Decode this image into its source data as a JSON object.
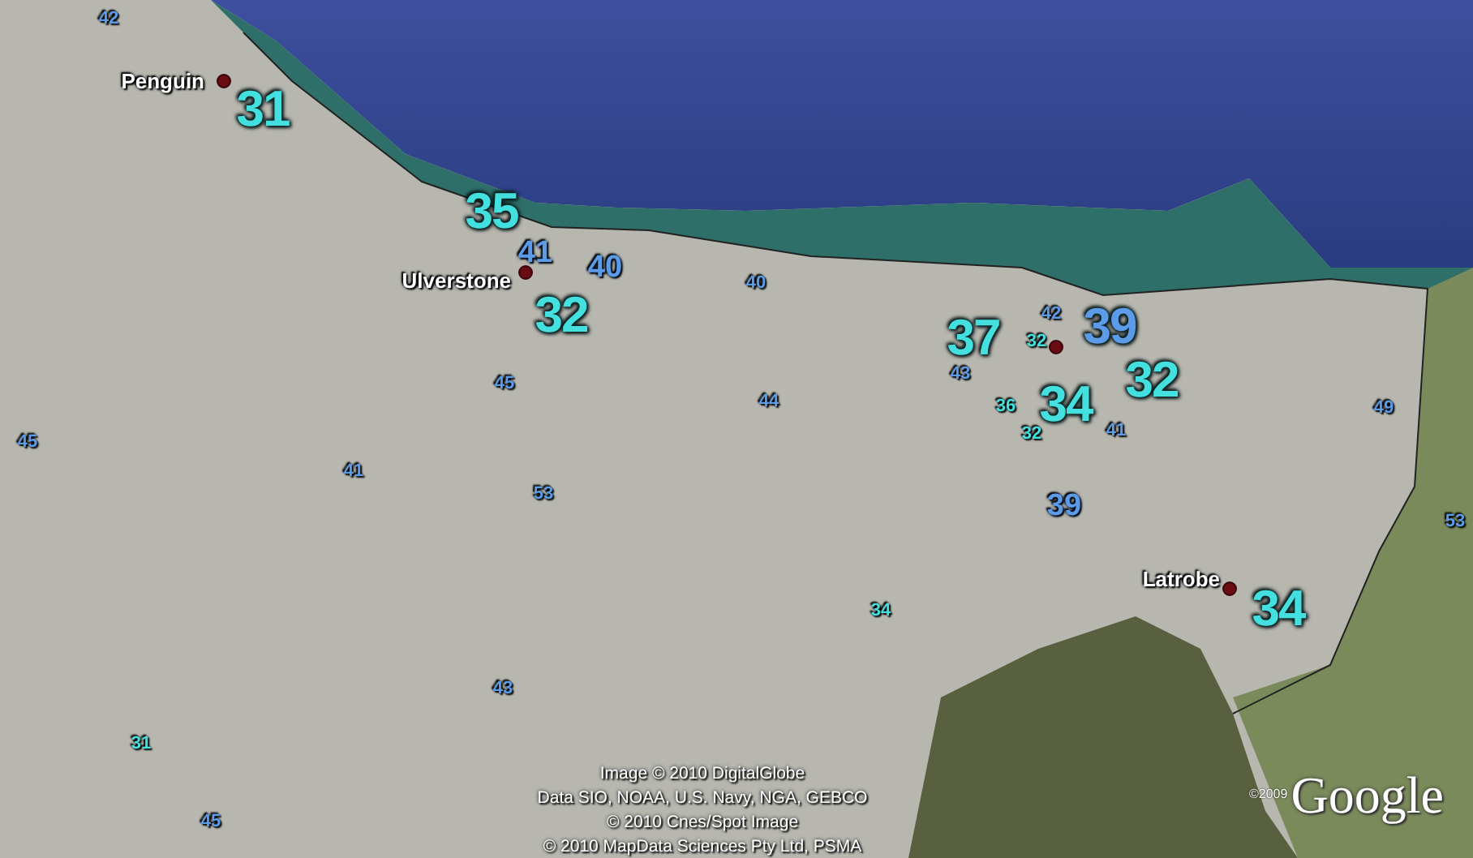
{
  "places": [
    {
      "name": "Penguin"
    },
    {
      "name": "Ulverstone"
    },
    {
      "name": "Latrobe"
    }
  ],
  "results": [
    {
      "value": "42",
      "color": "#5b9be8",
      "kind": "small"
    },
    {
      "value": "31",
      "color": "#44e0e0",
      "kind": "large"
    },
    {
      "value": "35",
      "color": "#44e0e0",
      "kind": "large"
    },
    {
      "value": "41",
      "color": "#5b9be8",
      "kind": "medium"
    },
    {
      "value": "40",
      "color": "#5b9be8",
      "kind": "medium"
    },
    {
      "value": "32",
      "color": "#44e0e0",
      "kind": "large"
    },
    {
      "value": "40",
      "color": "#5b9be8",
      "kind": "small"
    },
    {
      "value": "37",
      "color": "#44e0e0",
      "kind": "large"
    },
    {
      "value": "42",
      "color": "#5b9be8",
      "kind": "small"
    },
    {
      "value": "32",
      "color": "#44e0e0",
      "kind": "small"
    },
    {
      "value": "39",
      "color": "#5b9be8",
      "kind": "large"
    },
    {
      "value": "43",
      "color": "#5b9be8",
      "kind": "small"
    },
    {
      "value": "32",
      "color": "#44e0e0",
      "kind": "large"
    },
    {
      "value": "44",
      "color": "#5b9be8",
      "kind": "small"
    },
    {
      "value": "36",
      "color": "#44e0e0",
      "kind": "small"
    },
    {
      "value": "34",
      "color": "#44e0e0",
      "kind": "large"
    },
    {
      "value": "32",
      "color": "#44e0e0",
      "kind": "small"
    },
    {
      "value": "41",
      "color": "#5b9be8",
      "kind": "small"
    },
    {
      "value": "49",
      "color": "#5b9be8",
      "kind": "small"
    },
    {
      "value": "45",
      "color": "#5b9be8",
      "kind": "small"
    },
    {
      "value": "45",
      "color": "#5b9be8",
      "kind": "small"
    },
    {
      "value": "41",
      "color": "#5b9be8",
      "kind": "small"
    },
    {
      "value": "53",
      "color": "#5b9be8",
      "kind": "small"
    },
    {
      "value": "39",
      "color": "#5b9be8",
      "kind": "medium"
    },
    {
      "value": "53",
      "color": "#5b9be8",
      "kind": "small"
    },
    {
      "value": "34",
      "color": "#44e0e0",
      "kind": "small"
    },
    {
      "value": "34",
      "color": "#44e0e0",
      "kind": "large"
    },
    {
      "value": "43",
      "color": "#5b9be8",
      "kind": "small"
    },
    {
      "value": "31",
      "color": "#44e0e0",
      "kind": "small"
    },
    {
      "value": "45",
      "color": "#5b9be8",
      "kind": "small"
    }
  ],
  "attribution": [
    "Image © 2010 DigitalGlobe",
    "Data SIO, NOAA, U.S. Navy, NGA, GEBCO",
    "© 2010 Cnes/Spot Image",
    "© 2010 MapData Sciences Pty Ltd, PSMA"
  ],
  "logo": {
    "year": "©2009",
    "text": "Google"
  }
}
